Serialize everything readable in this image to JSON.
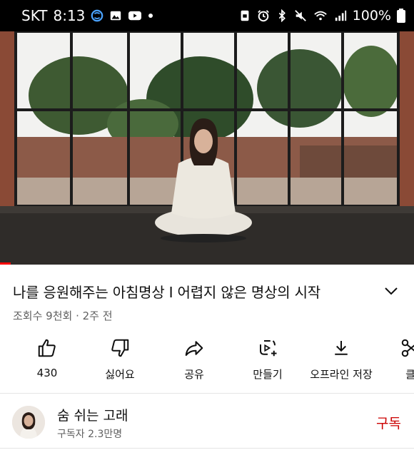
{
  "status_bar": {
    "carrier": "SKT",
    "time": "8:13",
    "battery": "100%",
    "icons": [
      "s-app-icon",
      "gallery-icon",
      "youtube-icon",
      "dot-icon",
      "nfc-icon",
      "alarm-icon",
      "bluetooth-icon",
      "mute-icon",
      "wifi-icon",
      "signal-icon",
      "battery-icon"
    ]
  },
  "video": {
    "title": "나를 응원해주는 아침명상 I  어렵지 않은 명상의 시작",
    "meta": "조회수 9천회 · 2주 전",
    "progress_fraction": 0.025
  },
  "actions": [
    {
      "name": "like",
      "label": "430",
      "icon": "thumbs-up-icon"
    },
    {
      "name": "dislike",
      "label": "싫어요",
      "icon": "thumbs-down-icon"
    },
    {
      "name": "share",
      "label": "공유",
      "icon": "share-icon"
    },
    {
      "name": "create",
      "label": "만들기",
      "icon": "create-icon"
    },
    {
      "name": "download",
      "label": "오프라인 저장",
      "icon": "download-icon"
    },
    {
      "name": "clip",
      "label": "클",
      "icon": "scissors-icon"
    }
  ],
  "channel": {
    "name": "숨 쉬는 고래",
    "subscribers": "구독자 2.3만명",
    "subscribe_label": "구독",
    "subscribe_color": "#cc0000"
  }
}
